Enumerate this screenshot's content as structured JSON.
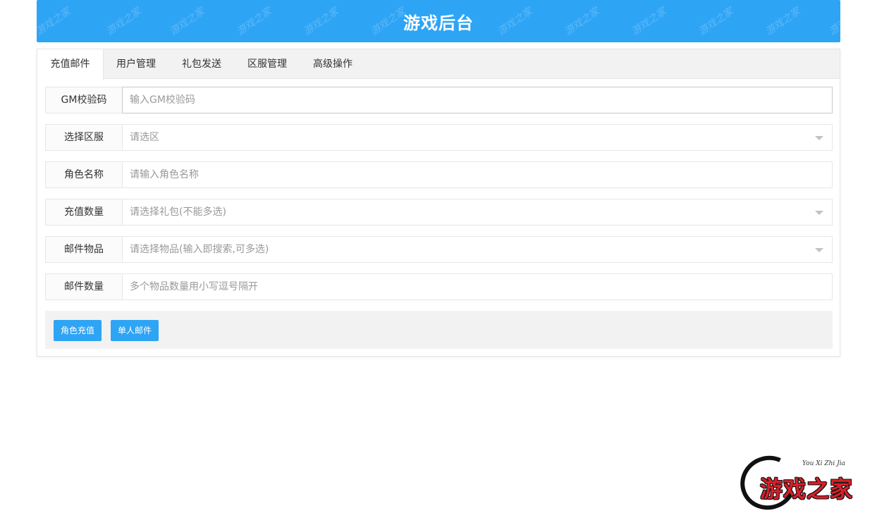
{
  "header": {
    "title": "游戏后台",
    "watermark": "游戏之家"
  },
  "tabs": [
    {
      "label": "充值邮件",
      "active": true
    },
    {
      "label": "用户管理",
      "active": false
    },
    {
      "label": "礼包发送",
      "active": false
    },
    {
      "label": "区服管理",
      "active": false
    },
    {
      "label": "高级操作",
      "active": false
    }
  ],
  "form": {
    "gm_code": {
      "label": "GM校验码",
      "placeholder": "输入GM校验码",
      "value": ""
    },
    "server": {
      "label": "选择区服",
      "placeholder": "请选区"
    },
    "role_name": {
      "label": "角色名称",
      "placeholder": "请输入角色名称",
      "value": ""
    },
    "recharge_amount": {
      "label": "充值数量",
      "placeholder": "请选择礼包(不能多选)"
    },
    "mail_items": {
      "label": "邮件物品",
      "placeholder": "请选择物品(输入即搜索,可多选)"
    },
    "mail_quantity": {
      "label": "邮件数量",
      "placeholder": "多个物品数量用小写逗号隔开",
      "value": ""
    }
  },
  "actions": {
    "recharge_label": "角色充值",
    "single_mail_label": "单人邮件"
  },
  "logo": {
    "text": "游戏之家",
    "sub": "You Xi Zhi Jia"
  },
  "colors": {
    "accent": "#2ea4f5",
    "logo_red": "#d8202a"
  }
}
